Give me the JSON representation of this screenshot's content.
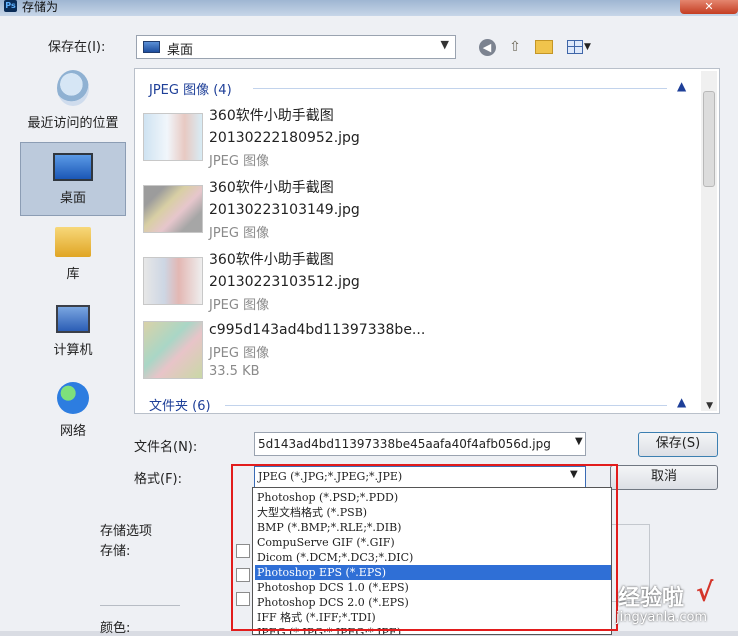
{
  "window": {
    "title": "存储为",
    "app_icon": "Ps"
  },
  "toolbar": {
    "save_in_label": "保存在(I):",
    "location": "桌面",
    "icons": [
      "back-icon",
      "up-folder-icon",
      "new-folder-icon",
      "views-menu-icon"
    ]
  },
  "places": [
    {
      "label": "最近访问的位置",
      "icon": "recent-places-icon"
    },
    {
      "label": "桌面",
      "icon": "desktop-icon",
      "selected": true
    },
    {
      "label": "库",
      "icon": "library-icon"
    },
    {
      "label": "计算机",
      "icon": "computer-icon"
    },
    {
      "label": "网络",
      "icon": "network-icon"
    }
  ],
  "groups": [
    {
      "title": "JPEG 图像 (4)"
    },
    {
      "title": "文件夹 (6)"
    }
  ],
  "files": [
    {
      "name1": "360软件小助手截图",
      "name2": "20130222180952.jpg",
      "type": "JPEG 图像"
    },
    {
      "name1": "360软件小助手截图",
      "name2": "20130223103149.jpg",
      "type": "JPEG 图像"
    },
    {
      "name1": "360软件小助手截图",
      "name2": "20130223103512.jpg",
      "type": "JPEG 图像"
    },
    {
      "name1": "c995d143ad4bd11397338be...",
      "type": "JPEG 图像",
      "size": "33.5 KB"
    }
  ],
  "form": {
    "filename_label": "文件名(N):",
    "filename_value": "5d143ad4bd11397338be45aafa40f4afb056d.jpg",
    "format_label": "格式(F):",
    "format_value": "JPEG (*.JPG;*.JPEG;*.JPE)",
    "save_button": "保存(S)",
    "cancel_button": "取消"
  },
  "options": {
    "title": "存储选项",
    "save_label": "存储:",
    "color_label": "颜色:"
  },
  "format_options": [
    "Photoshop (*.PSD;*.PDD)",
    "大型文档格式 (*.PSB)",
    "BMP (*.BMP;*.RLE;*.DIB)",
    "CompuServe GIF (*.GIF)",
    "Dicom (*.DCM;*.DC3;*.DIC)",
    "Photoshop EPS (*.EPS)",
    "Photoshop DCS 1.0 (*.EPS)",
    "Photoshop DCS 2.0 (*.EPS)",
    "IFF 格式 (*.IFF;*.TDI)",
    "JPEG (*.JPG;*.JPEG;*.JPE)"
  ],
  "selected_format_option": "Photoshop EPS (*.EPS)",
  "watermark": {
    "text": "经验啦",
    "url": "jingyanla.com",
    "check": "√"
  },
  "colors": {
    "selection": "#2f6fd6",
    "highlight_border": "#e21c1c",
    "group_heading": "#1e3f98"
  }
}
